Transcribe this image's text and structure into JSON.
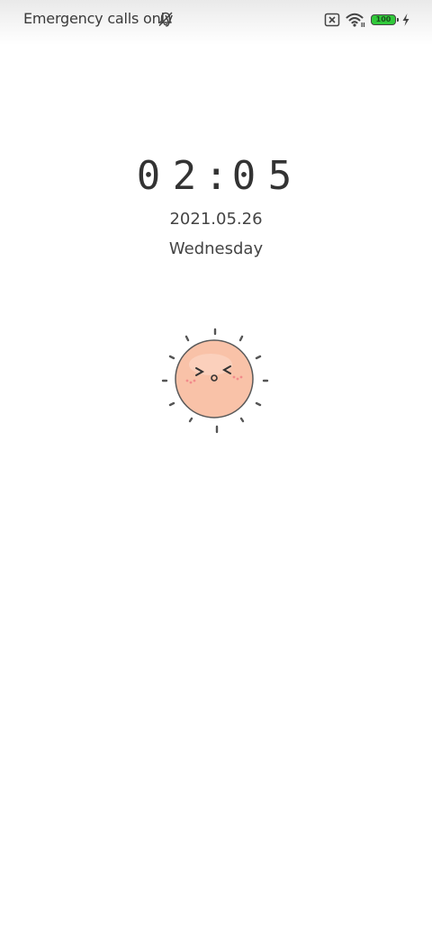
{
  "status_bar": {
    "carrier_text": "Emergency calls only",
    "battery_level": "100",
    "icons": [
      "bell-off-icon",
      "sim-card-error-icon",
      "wifi-icon",
      "battery-icon",
      "charging-bolt-icon"
    ]
  },
  "lockscreen": {
    "time_digits": [
      "0",
      "2",
      ":",
      "0",
      "5"
    ],
    "date": "2021.05.26",
    "weekday": "Wednesday"
  },
  "illustration": {
    "name": "smiling-sun-sticker",
    "color_face": "#f9c2a8"
  },
  "colors": {
    "text_primary": "#333333",
    "battery_fill": "#31c93b"
  }
}
